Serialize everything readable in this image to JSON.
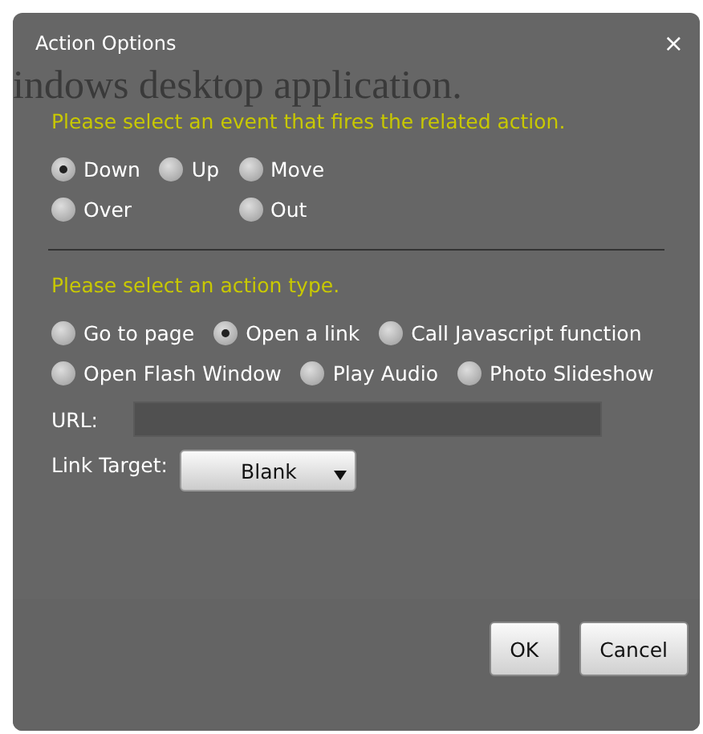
{
  "backdrop_text": "indows desktop application.",
  "dialog": {
    "title": "Action Options",
    "close": "×"
  },
  "events": {
    "prompt": "Please select an event that fires the related action.",
    "rows": [
      [
        {
          "label": "Down",
          "selected": true
        },
        {
          "label": "Up",
          "selected": false
        },
        {
          "label": "Move",
          "selected": false
        }
      ],
      [
        {
          "label": "Over",
          "selected": false
        },
        "",
        {
          "label": "Out",
          "selected": false
        }
      ]
    ]
  },
  "actions": {
    "prompt": "Please select an action type.",
    "rows": [
      [
        {
          "label": "Go to page",
          "selected": false
        },
        {
          "label": "Open a link",
          "selected": true
        },
        {
          "label": "Call Javascript function",
          "selected": false
        }
      ],
      [
        {
          "label": "Open Flash Window",
          "selected": false
        },
        {
          "label": "Play Audio",
          "selected": false
        },
        {
          "label": "Photo Slideshow",
          "selected": false
        }
      ]
    ]
  },
  "url": {
    "label": "URL:"
  },
  "link_target": {
    "label": "Link Target:",
    "value": "Blank"
  },
  "buttons": [
    "OK",
    "Cancel"
  ]
}
